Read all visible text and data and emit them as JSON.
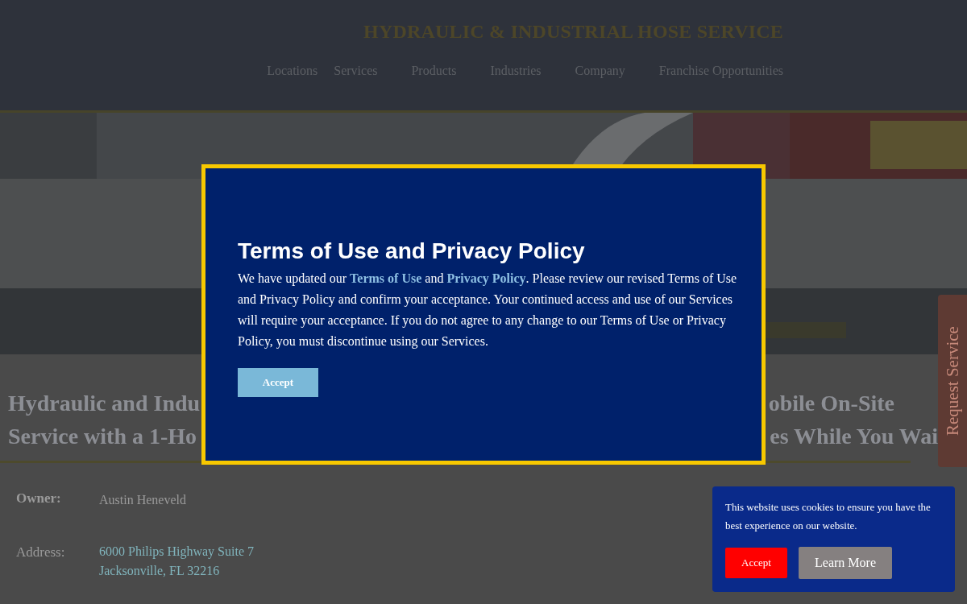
{
  "header": {
    "title": "HYDRAULIC & INDUSTRIAL HOSE SERVICE",
    "nav": [
      "Locations",
      "Services",
      "Products",
      "Industries",
      "Company",
      "Franchise Opportunities"
    ]
  },
  "side_tab": "Request Service",
  "headline": [
    {
      "left": "Hydraulic and Indu",
      "right": "obile On-Site"
    },
    {
      "left": "Service with a 1-Ho",
      "right": "es While You Wai"
    }
  ],
  "details": [
    {
      "label": "Owner:",
      "lines": [
        "Austin Heneveld"
      ],
      "link": false
    },
    {
      "label": "Address:",
      "lines": [
        "6000 Philips Highway Suite 7",
        "Jacksonville, FL 32216"
      ],
      "link": true
    }
  ],
  "modal": {
    "title": "Terms of Use and Privacy Policy",
    "text_1": "We have updated our",
    "link_1": "Terms of Use",
    "text_2": "and",
    "link_2": "Privacy Policy",
    "text_3": ". Please review our revised Terms of Use and Privacy Policy and confirm your acceptance. Your continued access and use of our Services will require your acceptance. If you do not agree to any change to our Terms of Use or Privacy Policy, you must discontinue using our Services.",
    "button": "Accept"
  },
  "cookie": {
    "text": "This website uses cookies to ensure you have the best experience on our website.",
    "buttons": [
      {
        "label": "Accept",
        "kind": "accept"
      },
      {
        "label": "Learn More",
        "kind": "more"
      }
    ]
  }
}
